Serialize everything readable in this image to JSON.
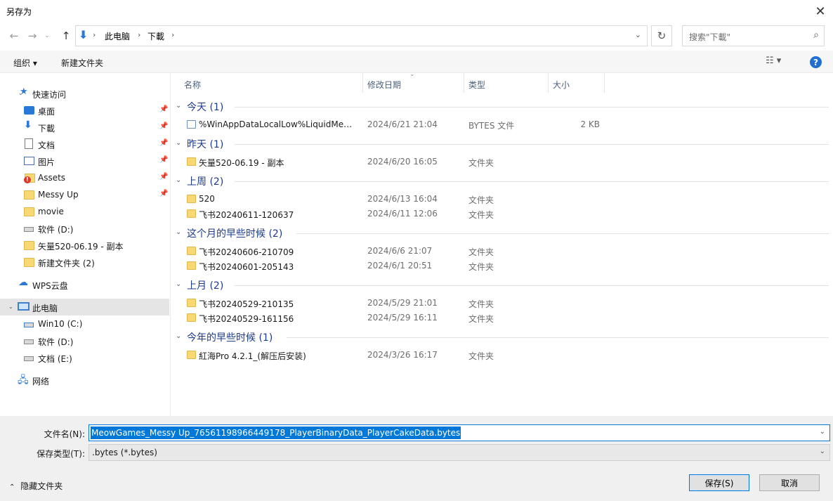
{
  "window": {
    "title": "另存为"
  },
  "nav": {
    "breadcrumb": [
      "此电脑",
      "下載"
    ],
    "search_placeholder": "搜索\"下載\""
  },
  "toolbar": {
    "organize": "组织 ▾",
    "new_folder": "新建文件夹"
  },
  "sidebar": {
    "items": [
      {
        "label": "快速访问",
        "icon": "star-icon"
      },
      {
        "label": "桌面",
        "icon": "desktop-icon",
        "pinned": true
      },
      {
        "label": "下載",
        "icon": "download-icon",
        "pinned": true
      },
      {
        "label": "文档",
        "icon": "document-icon",
        "pinned": true
      },
      {
        "label": "图片",
        "icon": "picture-icon",
        "pinned": true
      },
      {
        "label": "Assets",
        "icon": "folder-warning-icon",
        "pinned": true
      },
      {
        "label": "Messy Up",
        "icon": "folder-icon",
        "pinned": true
      },
      {
        "label": "movie",
        "icon": "folder-icon"
      },
      {
        "label": "软件 (D:)",
        "icon": "drive-icon"
      },
      {
        "label": "矢量520-06.19 - 副本",
        "icon": "folder-icon"
      },
      {
        "label": "新建文件夹 (2)",
        "icon": "folder-icon"
      },
      {
        "label": "WPS云盘",
        "icon": "cloud-icon"
      },
      {
        "label": "此电脑",
        "icon": "computer-icon",
        "selected": true
      },
      {
        "label": "Win10 (C:)",
        "icon": "system-drive-icon"
      },
      {
        "label": "软件 (D:)",
        "icon": "drive-icon"
      },
      {
        "label": "文档 (E:)",
        "icon": "drive-icon"
      },
      {
        "label": "网络",
        "icon": "network-icon"
      }
    ]
  },
  "columns": {
    "name": "名称",
    "date": "修改日期",
    "type": "类型",
    "size": "大小"
  },
  "groups": [
    {
      "label": "今天 (1)",
      "files": [
        {
          "name": "%WinAppDataLocalLow%LiquidMeo...",
          "date": "2024/6/21 21:04",
          "type": "BYTES 文件",
          "size": "2 KB",
          "kind": "bytes"
        }
      ]
    },
    {
      "label": "昨天 (1)",
      "files": [
        {
          "name": "矢量520-06.19 - 副本",
          "date": "2024/6/20 16:05",
          "type": "文件夹",
          "size": "",
          "kind": "folder"
        }
      ]
    },
    {
      "label": "上周 (2)",
      "files": [
        {
          "name": "520",
          "date": "2024/6/13 16:04",
          "type": "文件夹",
          "size": "",
          "kind": "folder"
        },
        {
          "name": "飞书20240611-120637",
          "date": "2024/6/11 12:06",
          "type": "文件夹",
          "size": "",
          "kind": "folder"
        }
      ]
    },
    {
      "label": "这个月的早些时候 (2)",
      "files": [
        {
          "name": "飞书20240606-210709",
          "date": "2024/6/6 21:07",
          "type": "文件夹",
          "size": "",
          "kind": "folder"
        },
        {
          "name": "飞书20240601-205143",
          "date": "2024/6/1 20:51",
          "type": "文件夹",
          "size": "",
          "kind": "folder"
        }
      ]
    },
    {
      "label": "上月 (2)",
      "files": [
        {
          "name": "飞书20240529-210135",
          "date": "2024/5/29 21:01",
          "type": "文件夹",
          "size": "",
          "kind": "folder"
        },
        {
          "name": "飞书20240529-161156",
          "date": "2024/5/29 16:11",
          "type": "文件夹",
          "size": "",
          "kind": "folder"
        }
      ]
    },
    {
      "label": "今年的早些时候 (1)",
      "files": [
        {
          "name": "紅海Pro 4.2.1_(解压后安装)",
          "date": "2024/3/26 16:17",
          "type": "文件夹",
          "size": "",
          "kind": "folder"
        }
      ]
    }
  ],
  "footer": {
    "filename_label": "文件名(N):",
    "filename_value": "MeowGames_Messy Up_76561198966449178_PlayerBinaryData_PlayerCakeData.bytes",
    "filetype_label": "保存类型(T):",
    "filetype_value": ".bytes (*.bytes)",
    "hide_folders": "隐藏文件夹",
    "save": "保存(S)",
    "cancel": "取消"
  }
}
